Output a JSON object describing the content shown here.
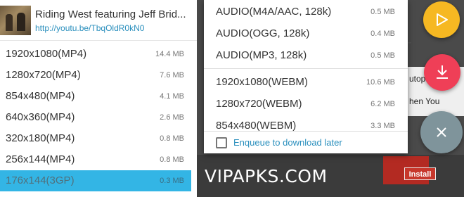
{
  "video": {
    "title": "Riding West featuring Jeff Brid...",
    "url": "http://youtu.be/TbqOldR0kN0"
  },
  "left_formats": [
    {
      "label": "1920x1080(MP4)",
      "size": "14.4 MB"
    },
    {
      "label": "1280x720(MP4)",
      "size": "7.6 MB"
    },
    {
      "label": "854x480(MP4)",
      "size": "4.1 MB"
    },
    {
      "label": "640x360(MP4)",
      "size": "2.6 MB"
    },
    {
      "label": "320x180(MP4)",
      "size": "0.8 MB"
    },
    {
      "label": "256x144(MP4)",
      "size": "0.8 MB"
    },
    {
      "label": "176x144(3GP)",
      "size": "0.3 MB"
    }
  ],
  "right_formats_audio": [
    {
      "label": "AUDIO(M4A/AAC, 128k)",
      "size": "0.5 MB"
    },
    {
      "label": "AUDIO(OGG, 128k)",
      "size": "0.4 MB"
    },
    {
      "label": "AUDIO(MP3, 128k)",
      "size": "0.5 MB"
    }
  ],
  "right_formats_video": [
    {
      "label": "1920x1080(WEBM)",
      "size": "10.6 MB"
    },
    {
      "label": "1280x720(WEBM)",
      "size": "6.2 MB"
    },
    {
      "label": "854x480(WEBM)",
      "size": "3.3 MB"
    }
  ],
  "enqueue_label": "Enqueue to download later",
  "background": {
    "snippet1": "utop",
    "snippet2": "hen You",
    "install_label": "Install",
    "plus_glyph": "+"
  },
  "watermark": "VIPAPKS.COM",
  "colors": {
    "accent_blue": "#33b5e5",
    "link_blue": "#2a8fbd",
    "fab_play": "#f6b822",
    "fab_download": "#ef3f57",
    "fab_close": "#7f949b"
  },
  "icons": {
    "play": "play-icon",
    "download": "download-icon",
    "close": "close-icon"
  }
}
